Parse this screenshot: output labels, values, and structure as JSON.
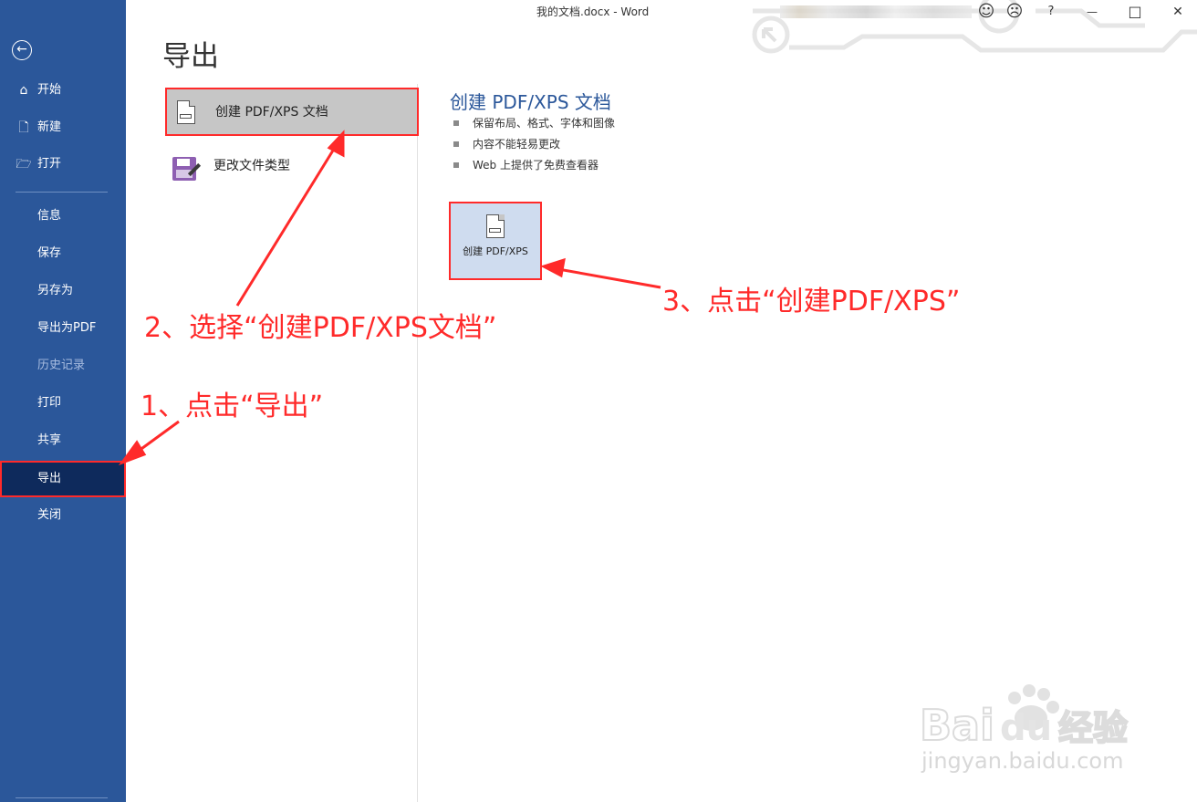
{
  "titlebar": {
    "title": "我的文档.docx  -  Word",
    "smile": "☺",
    "frown": "☹",
    "help": "?",
    "minimize": "—",
    "maximize": "□",
    "close": "✕"
  },
  "sidebar": {
    "back_icon": "←",
    "items": [
      {
        "icon": "⌂",
        "label": "开始"
      },
      {
        "icon": "🗋",
        "label": "新建"
      },
      {
        "icon": "🗁",
        "label": "打开"
      },
      {
        "label": "信息"
      },
      {
        "label": "保存"
      },
      {
        "label": "另存为"
      },
      {
        "label": "导出为PDF"
      },
      {
        "label": "历史记录",
        "disabled": true
      },
      {
        "label": "打印"
      },
      {
        "label": "共享"
      },
      {
        "label": "导出",
        "active": true
      },
      {
        "label": "关闭"
      }
    ]
  },
  "main": {
    "title": "导出",
    "options": [
      {
        "label": "创建 PDF/XPS 文档",
        "icon": "pdf-document-icon",
        "selected": true
      },
      {
        "label": "更改文件类型",
        "icon": "save-as-floppy-icon"
      }
    ],
    "detail": {
      "title": "创建 PDF/XPS 文档",
      "bullets": [
        "保留布局、格式、字体和图像",
        "内容不能轻易更改",
        "Web 上提供了免费查看器"
      ],
      "button_label": "创建 PDF/XPS"
    }
  },
  "annotations": {
    "step1": "1、点击“导出”",
    "step2": "2、选择“创建PDF/XPS文档”",
    "step3": "3、点击“创建PDF/XPS”",
    "color": "#ff2a2a"
  },
  "watermark": {
    "logo_text": "Baidu经验",
    "url": "jingyan.baidu.com"
  },
  "colors": {
    "sidebar": "#2b579a",
    "active_item": "#0e2a5c",
    "accent": "#2b579a"
  }
}
